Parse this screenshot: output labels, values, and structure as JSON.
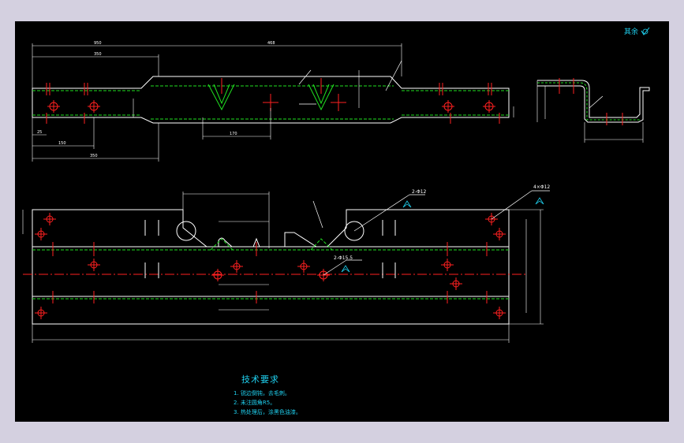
{
  "colors": {
    "background": "#000000",
    "outline": "#ffffff",
    "center_line": "#ff2020",
    "hidden_line": "#20e020",
    "hole": "#ff2020",
    "annotation": "#1fd1f0"
  },
  "roughness": {
    "label": "其余",
    "symbol": "surface-roughness-check-icon"
  },
  "tech_requirements": {
    "title": "技术要求",
    "items": [
      "1. 锐边倒钝，去毛刺。",
      "2. 未注圆角R5。",
      "3. 热处理后，涂黑色油漆。"
    ]
  },
  "callouts": {
    "top_hole_note": "2-Φ12",
    "mid_hole_note": "2-Φ15.5",
    "right_hole_note": "4×Φ12"
  }
}
